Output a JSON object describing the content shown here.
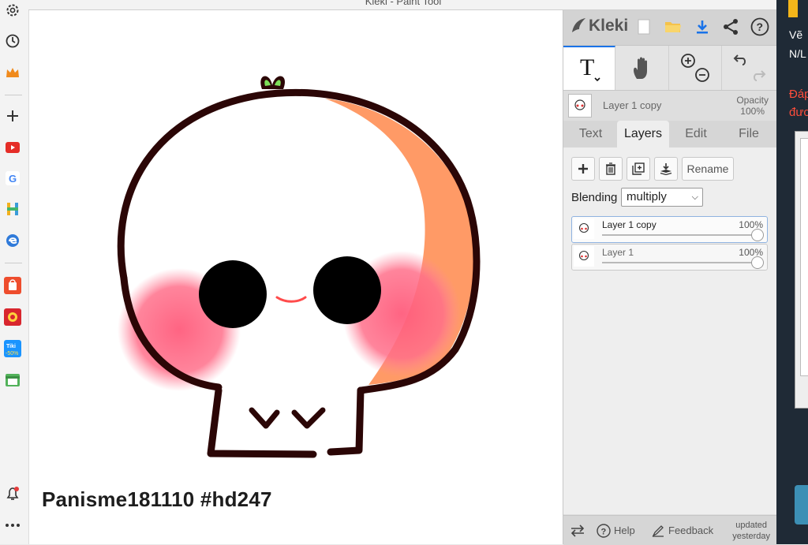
{
  "window": {
    "title": "Kleki - Paint Tool"
  },
  "canvas": {
    "signature": "Panisme181110 #hd247"
  },
  "panel": {
    "logo_text": "Kleki",
    "current_layer_name": "Layer 1 copy",
    "opacity_label": "Opacity",
    "opacity_value": "100%",
    "tabs": [
      {
        "label": "Text"
      },
      {
        "label": "Layers"
      },
      {
        "label": "Edit"
      },
      {
        "label": "File"
      }
    ],
    "active_tab": "Layers",
    "layer_buttons": {
      "rename_label": "Rename"
    },
    "blending": {
      "label": "Blending",
      "value": "multiply"
    },
    "layers": [
      {
        "name": "Layer 1 copy",
        "opacity": "100%",
        "selected": true
      },
      {
        "name": "Layer 1",
        "opacity": "100%",
        "selected": false
      }
    ],
    "bottom": {
      "help_label": "Help",
      "feedback_label": "Feedback",
      "updated_line1": "updated",
      "updated_line2": "yesterday"
    }
  },
  "right_page": {
    "line1": "Vẽ",
    "line2": "N/L",
    "line3": "Đáp",
    "line4": "đươ"
  },
  "colors": {
    "accent_blue": "#1a73e8",
    "skin_orange": "#ff9a66",
    "blush_pink": "#ff6f8a",
    "outline": "#3a0d0d",
    "sprout_green": "#7ee05a"
  }
}
